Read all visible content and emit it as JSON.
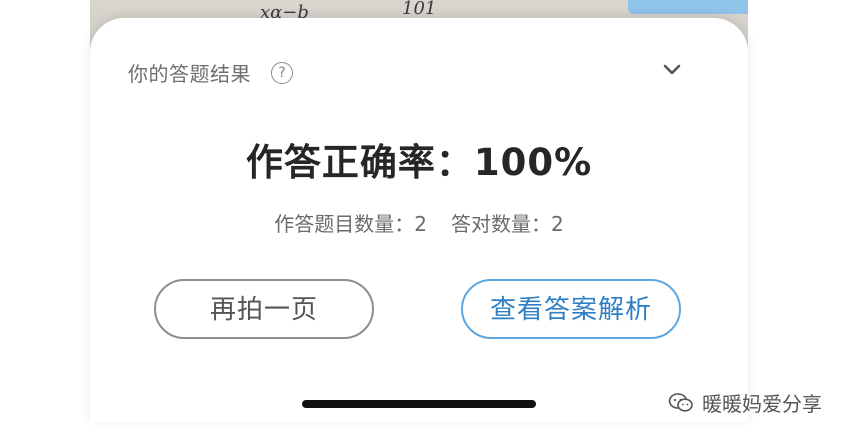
{
  "photo": {
    "scribble_1": "xα−b",
    "scribble_2": "101"
  },
  "sheet": {
    "header_title": "你的答题结果",
    "help_symbol": "?",
    "accuracy_text": "作答正确率：100%",
    "accuracy_value": 100,
    "answered_text": "作答题目数量：2",
    "correct_text": "答对数量：2",
    "retake_label": "再拍一页",
    "view_answers_label": "查看答案解析"
  },
  "watermark": {
    "text": "暖暖妈爱分享"
  },
  "colors": {
    "accent_blue": "#2f7fc4",
    "accent_blue_border": "#5ea6e0",
    "text_dark": "#262626",
    "text_muted": "#6a6a6a"
  },
  "icons": {
    "help": "help-circle-icon",
    "collapse": "chevron-down-icon",
    "watermark": "wechat-icon"
  }
}
